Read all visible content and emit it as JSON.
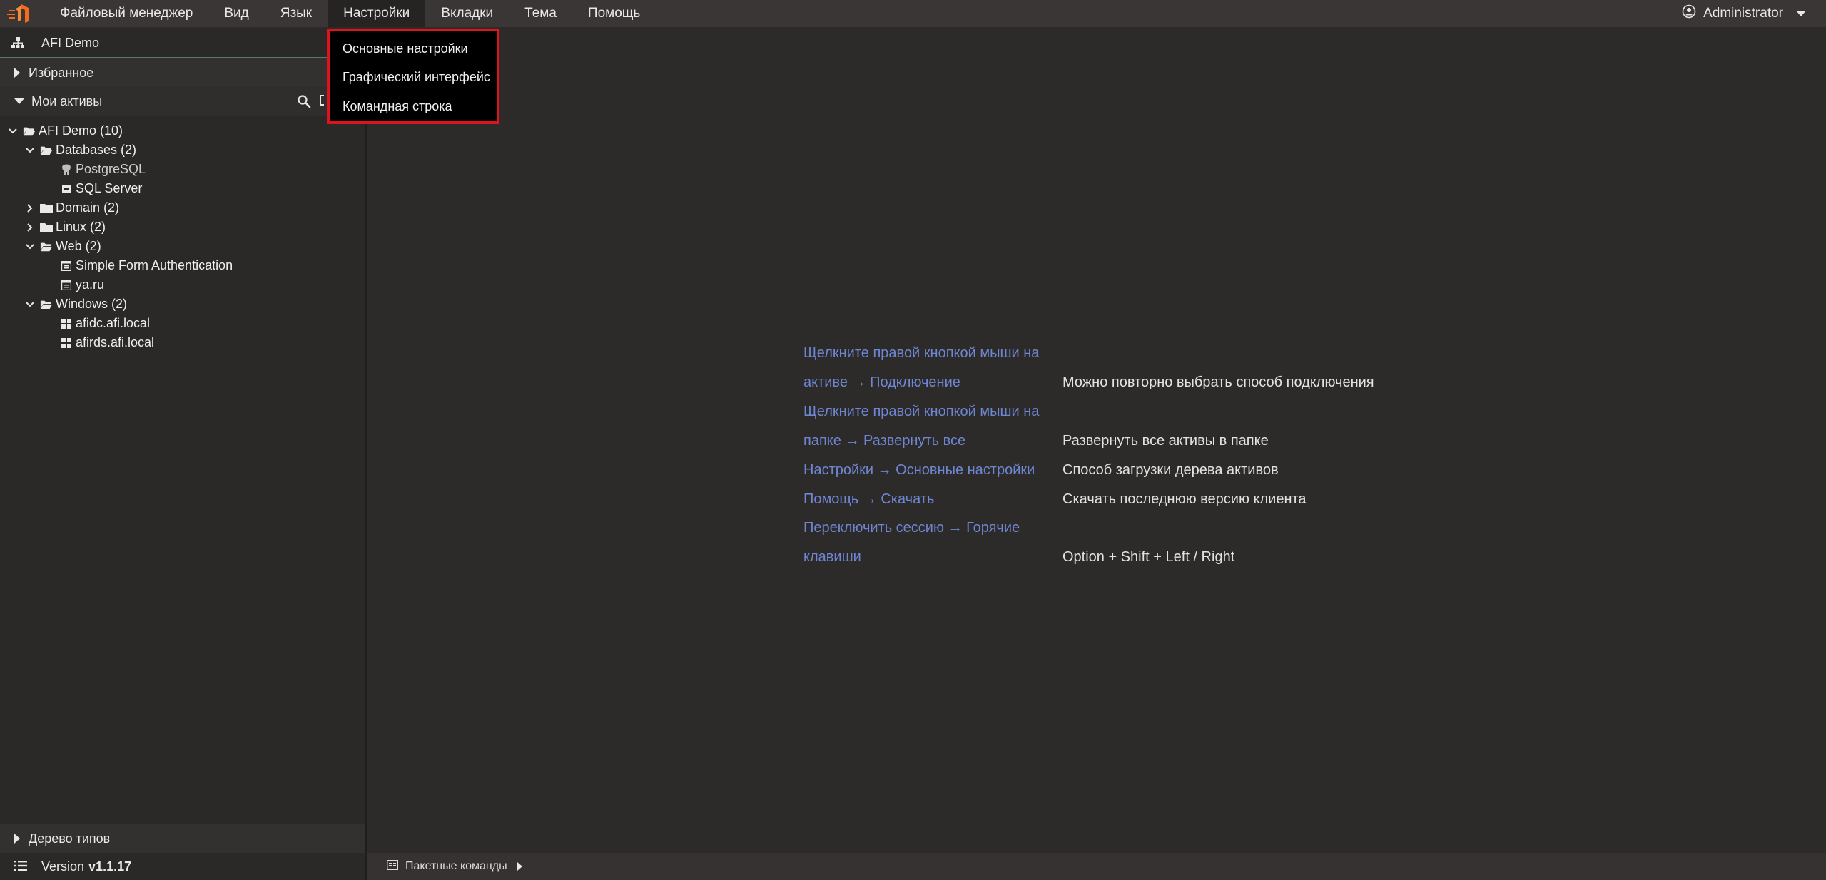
{
  "menubar": {
    "items": [
      "Файловый менеджер",
      "Вид",
      "Язык",
      "Настройки",
      "Вкладки",
      "Тема",
      "Помощь"
    ],
    "active_index": 3,
    "user": "Administrator"
  },
  "dropdown": {
    "items": [
      "Основные настройки",
      "Графический интерфейс",
      "Командная строка"
    ]
  },
  "sidebar": {
    "workspace": "AFI Demo",
    "favorites": "Избранное",
    "my_assets": "Мои активы",
    "tree": [
      {
        "label": "AFI Demo (10)"
      },
      {
        "label": "Databases (2)"
      },
      {
        "label": "PostgreSQL"
      },
      {
        "label": "SQL Server"
      },
      {
        "label": "Domain (2)"
      },
      {
        "label": "Linux (2)"
      },
      {
        "label": "Web (2)"
      },
      {
        "label": "Simple Form Authentication"
      },
      {
        "label": "ya.ru"
      },
      {
        "label": "Windows (2)"
      },
      {
        "label": "afidc.afi.local"
      },
      {
        "label": "afirds.afi.local"
      }
    ],
    "type_tree": "Дерево типов",
    "version_label": "Version",
    "version_value": "v1.1.17"
  },
  "hints": {
    "left": [
      "Щелкните правой кнопкой мыши на",
      "активе → Подключение",
      "Щелкните правой кнопкой мыши на",
      "папке → Развернуть все",
      "Настройки → Основные настройки",
      "Помощь → Скачать",
      "Переключить сессию → Горячие",
      "клавиши"
    ],
    "right": [
      "Можно повторно выбрать способ подключения",
      "Развернуть все активы в папке",
      "Способ загрузки дерева активов",
      "Скачать последнюю версию клиента",
      "Option + Shift + Left / Right"
    ]
  },
  "bottom": {
    "batch_commands": "Пакетные команды"
  },
  "colors": {
    "menubar": "#3a3636",
    "background": "#2d2a2a",
    "hint_link": "#6e87d3",
    "dropdown_border": "#e0121a",
    "accent_logo": "#f26b1d"
  }
}
